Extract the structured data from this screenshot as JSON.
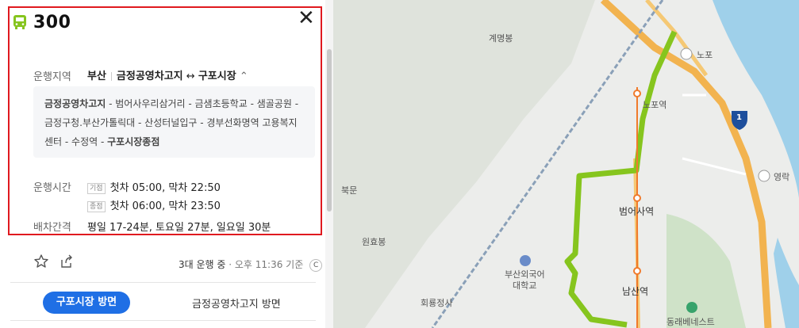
{
  "route": {
    "number": "300"
  },
  "info": {
    "area_label": "운행지역",
    "area_region": "부산",
    "area_from": "금정공영차고지",
    "area_arrow": "↔",
    "area_to": "구포시장",
    "area_toggle": "⌃",
    "stops_start": "금정공영차고지",
    "stops_middle": " - 범어사우리삼거리 - 금샘초등학교 - 샘골공원 - 금정구청.부산가톨릭대 - 산성터널입구 - 경부선화명역 고용복지센터 - 수정역 - ",
    "stops_end": "구포시장종점",
    "hours_label": "운행시간",
    "hours_weekday_tag": "기점",
    "hours_weekday": "첫차 05:00, 막차 22:50",
    "hours_end_tag": "종점",
    "hours_end": "첫차 06:00, 막차 23:50",
    "interval_label": "배차간격",
    "interval_value": "평일 17-24분, 토요일 27분, 일요일 30분"
  },
  "status": {
    "running": "3대 운행 중",
    "dot": " · ",
    "time": "오후 11:36 기준"
  },
  "directions": {
    "active": "구포시장 방면",
    "other": "금정공영차고지 방면"
  },
  "map": {
    "labels": [
      "계명봉",
      "노포",
      "노포역",
      "IC",
      "영락",
      "북문",
      "원효봉",
      "범어사역",
      "부산외국어",
      "대학교",
      "남산역",
      "회룡정사",
      "동래베네스트"
    ],
    "highway_shield": "1"
  },
  "colors": {
    "accent": "#1f6fe5",
    "route_line": "#86c51e",
    "highlight": "#e0191f"
  }
}
